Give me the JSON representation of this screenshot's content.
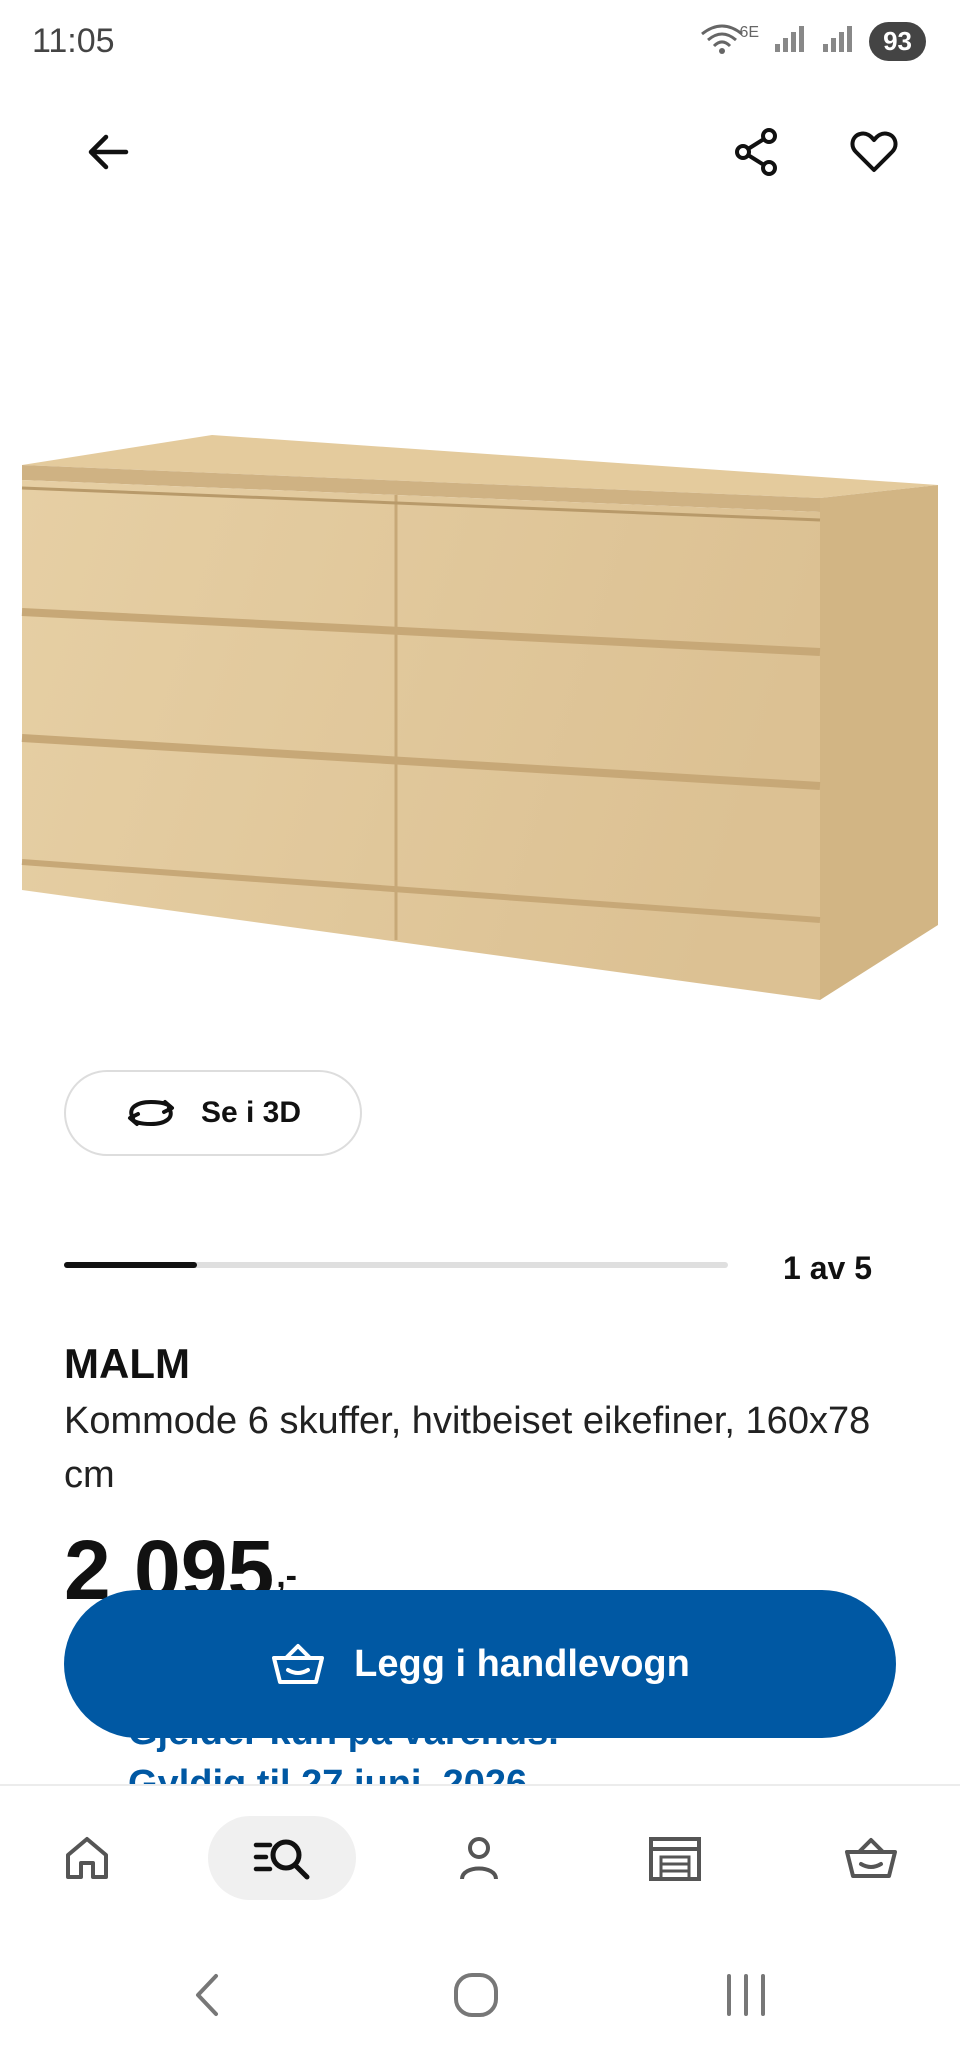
{
  "status": {
    "time": "11:05",
    "battery": "93",
    "wifi_label": "6E"
  },
  "product": {
    "name": "MALM",
    "description": "Kommode 6 skuffer, hvitbeiset eikefiner, 160x78 cm",
    "price": "2 095",
    "price_suffix": ",-",
    "validity_line1": "Gjelder kun på varehus.",
    "validity_line2": "Gyldig til 27 juni. 2026"
  },
  "view3d": {
    "label": "Se i 3D"
  },
  "carousel": {
    "counter": "1 av 5",
    "progress": 0.2
  },
  "cart": {
    "label": "Legg i handlevogn"
  },
  "nav": {
    "items": [
      "home-icon",
      "search-browse-icon",
      "profile-icon",
      "store-icon",
      "cart-icon"
    ],
    "active": "search-browse-icon"
  },
  "colors": {
    "brand_blue": "#0058a3",
    "text": "#111111"
  }
}
